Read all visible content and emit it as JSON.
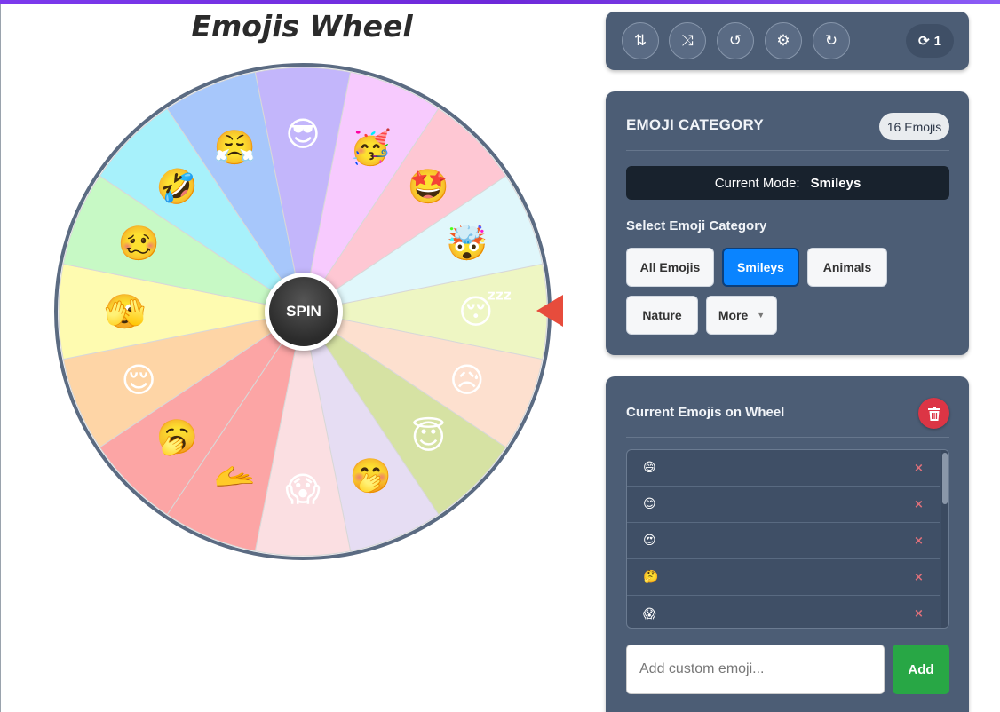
{
  "title": "Emojis Wheel",
  "wheel": {
    "spin_label": "SPIN",
    "border_color": "#5b6b82",
    "pointer_color": "#e74c3c",
    "segments": [
      {
        "emoji": "😴",
        "color": "#eef6c3"
      },
      {
        "emoji": "😥",
        "color": "#fde0cf"
      },
      {
        "emoji": "😇",
        "color": "#d6e2a3"
      },
      {
        "emoji": "🤭",
        "color": "#e6ddf3"
      },
      {
        "emoji": "😱",
        "color": "#fbdfe2"
      },
      {
        "emoji": "🫴",
        "color": "#fca5a5"
      },
      {
        "emoji": "🥱",
        "color": "#fca5a5"
      },
      {
        "emoji": "😌",
        "color": "#fed5a6"
      },
      {
        "emoji": "🫣",
        "color": "#fefbb0"
      },
      {
        "emoji": "🥴",
        "color": "#c7f9c5"
      },
      {
        "emoji": "🤣",
        "color": "#a7f1fb"
      },
      {
        "emoji": "😤",
        "color": "#a7c7fb"
      },
      {
        "emoji": "😎",
        "color": "#c3b6fb"
      },
      {
        "emoji": "🥳",
        "color": "#f7cafe"
      },
      {
        "emoji": "🤩",
        "color": "#fec7d3"
      },
      {
        "emoji": "🤯",
        "color": "#e0f7fb"
      }
    ]
  },
  "toolbar": {
    "buttons": [
      {
        "name": "sort-icon",
        "glyph": "⇅"
      },
      {
        "name": "shuffle-icon",
        "glyph": "⤨"
      },
      {
        "name": "history-icon",
        "glyph": "↺"
      },
      {
        "name": "gear-icon",
        "glyph": "⚙"
      },
      {
        "name": "redo-icon",
        "glyph": "↻"
      }
    ],
    "spin_count_icon": "⟳",
    "spin_count": "1"
  },
  "category": {
    "heading": "EMOJI CATEGORY",
    "count_badge": "16 Emojis",
    "mode_label": "Current Mode:",
    "mode_value": "Smileys",
    "select_label": "Select Emoji Category",
    "buttons": [
      "All Emojis",
      "Smileys",
      "Animals",
      "Nature",
      "More"
    ],
    "active": "Smileys"
  },
  "current": {
    "heading": "Current Emojis on Wheel",
    "items": [
      "😄",
      "😊",
      "😍",
      "🤔",
      "😱"
    ],
    "remove_glyph": "×",
    "input_placeholder": "Add custom emoji...",
    "add_label": "Add"
  }
}
